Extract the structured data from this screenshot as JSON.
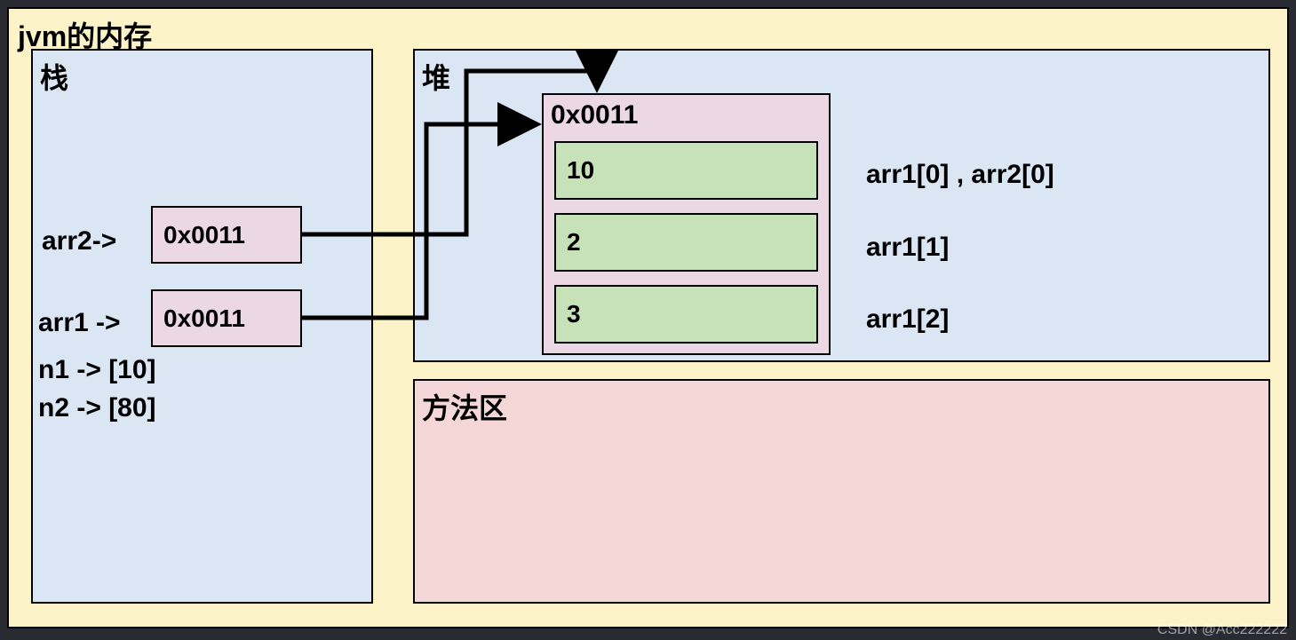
{
  "title": "jvm的内存",
  "stack": {
    "title": "栈",
    "arr2_label": "arr2->",
    "arr2_ref": "0x0011",
    "arr1_label": "arr1 ->",
    "arr1_ref": "0x0011",
    "n1": "n1 -> [10]",
    "n2": "n2 -> [80]"
  },
  "heap": {
    "title": "堆",
    "obj_addr": "0x0011",
    "cells": [
      "10",
      "2",
      "3"
    ],
    "annot0": "arr1[0] , arr2[0]",
    "annot1": "arr1[1]",
    "annot2": "arr1[2]"
  },
  "method_area": {
    "title": "方法区"
  },
  "watermark": "CSDN @Acc222222",
  "chart_data": {
    "type": "diagram",
    "description": "JVM memory model showing stack variables arr1 and arr2 both pointing to heap object at address 0x0011, which is an array with elements [10, 2, 3]. Stack also holds primitives n1=10, n2=80. A method area region is shown empty.",
    "stack_frame": {
      "arr2": "0x0011",
      "arr1": "0x0011",
      "n1": 10,
      "n2": 80
    },
    "heap_objects": [
      {
        "address": "0x0011",
        "type": "int[]",
        "values": [
          10,
          2,
          3
        ]
      }
    ],
    "index_annotations": {
      "0": "arr1[0] , arr2[0]",
      "1": "arr1[1]",
      "2": "arr1[2]"
    },
    "method_area": {}
  }
}
